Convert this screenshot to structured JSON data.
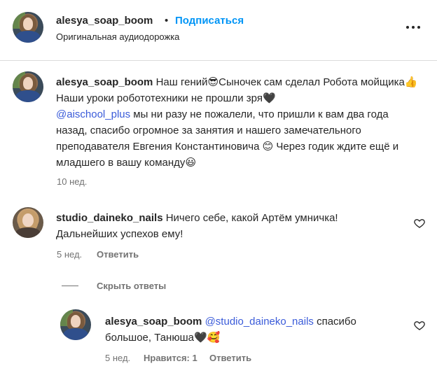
{
  "header": {
    "username": "alesya_soap_boom",
    "separator": "•",
    "follow_label": "Подписаться",
    "subtitle": "Оригинальная аудиодорожка",
    "more_icon": "more-horizontal-icon"
  },
  "caption": {
    "username": "alesya_soap_boom",
    "part1": "Наш гений",
    "emoji1": "😎",
    "part2": "Сыночек сам сделал Робота мойщика",
    "emoji2": "👍",
    "part3": "Наши уроки робототехники не прошли зря",
    "emoji3": "🖤",
    "mention": "@aischool_plus",
    "part4": " мы ни разу не пожалели, что пришли к вам два года назад, спасибо огромное за занятия и нашего замечательного преподавателя Евгения Константиновича ",
    "emoji4": "😊",
    "part5": " Через годик ждите ещё и младшего в вашу команду",
    "emoji5": "😃",
    "time": "10 нед."
  },
  "comment1": {
    "username": "studio_daineko_nails",
    "text": "Ничего себе, какой Артём умничка! Дальнейших успехов ему!",
    "time": "5 нед.",
    "reply_label": "Ответить",
    "hide_replies_label": "Скрыть ответы"
  },
  "reply1": {
    "username": "alesya_soap_boom",
    "mention": "@studio_daineko_nails",
    "text": " спасибо большое, Танюша",
    "emoji1": "🖤",
    "emoji2": "🥰",
    "time": "5 нед.",
    "likes_label": "Нравится: 1",
    "reply_label": "Ответить"
  }
}
